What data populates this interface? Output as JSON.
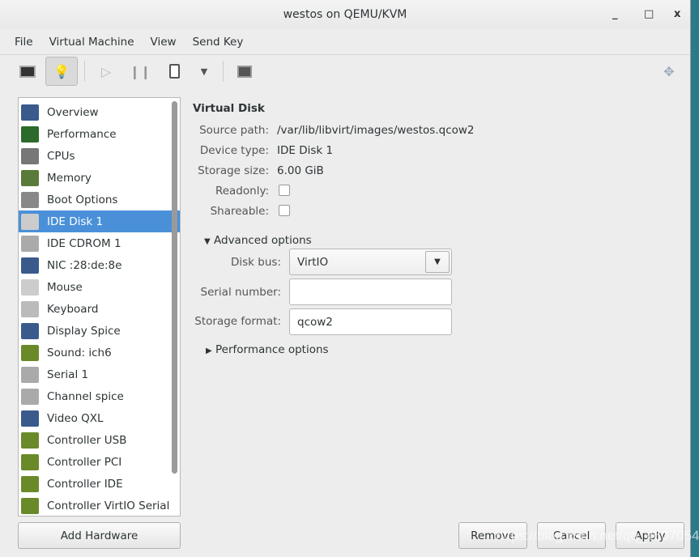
{
  "window": {
    "title": "westos on QEMU/KVM",
    "minimize": "_",
    "maximize": "□",
    "close": "x"
  },
  "menu": [
    "File",
    "Virtual Machine",
    "View",
    "Send Key"
  ],
  "toolbar": [
    "console-icon",
    "details-lightbulb-icon",
    "run-icon",
    "pause-icon",
    "shutdown-icon",
    "dropdown-icon",
    "snapshots-icon",
    "fullscreen-icon"
  ],
  "sidebar": {
    "items": [
      {
        "label": "Overview",
        "color": "#3a5a8c"
      },
      {
        "label": "Performance",
        "color": "#2a6a2a"
      },
      {
        "label": "CPUs",
        "color": "#777"
      },
      {
        "label": "Memory",
        "color": "#5a7a3a"
      },
      {
        "label": "Boot Options",
        "color": "#888"
      },
      {
        "label": "IDE Disk 1",
        "color": "#ccc"
      },
      {
        "label": "IDE CDROM 1",
        "color": "#aaa"
      },
      {
        "label": "NIC :28:de:8e",
        "color": "#3a5a8c"
      },
      {
        "label": "Mouse",
        "color": "#ccc"
      },
      {
        "label": "Keyboard",
        "color": "#bbb"
      },
      {
        "label": "Display Spice",
        "color": "#3a5a8c"
      },
      {
        "label": "Sound: ich6",
        "color": "#6a8a2a"
      },
      {
        "label": "Serial 1",
        "color": "#aaa"
      },
      {
        "label": "Channel spice",
        "color": "#aaa"
      },
      {
        "label": "Video QXL",
        "color": "#3a5a8c"
      },
      {
        "label": "Controller USB",
        "color": "#6a8a2a"
      },
      {
        "label": "Controller PCI",
        "color": "#6a8a2a"
      },
      {
        "label": "Controller IDE",
        "color": "#6a8a2a"
      },
      {
        "label": "Controller VirtIO Serial",
        "color": "#6a8a2a"
      }
    ],
    "selected": "IDE Disk 1",
    "add_hardware": "Add Hardware"
  },
  "disk": {
    "heading": "Virtual Disk",
    "source_path_label": "Source path:",
    "source_path": "/var/lib/libvirt/images/westos.qcow2",
    "device_type_label": "Device type:",
    "device_type": "IDE Disk 1",
    "storage_size_label": "Storage size:",
    "storage_size": "6.00 GiB",
    "readonly_label": "Readonly:",
    "readonly": false,
    "shareable_label": "Shareable:",
    "shareable": false,
    "advanced": "Advanced options",
    "disk_bus_label": "Disk bus:",
    "disk_bus": "VirtIO",
    "serial_label": "Serial number:",
    "serial": "",
    "format_label": "Storage format:",
    "format": "qcow2",
    "performance": "Performance options"
  },
  "buttons": {
    "remove": "Remove",
    "cancel": "Cancel",
    "apply": "Apply"
  },
  "watermark": "https://blog.csdn.net/qq_46070541"
}
